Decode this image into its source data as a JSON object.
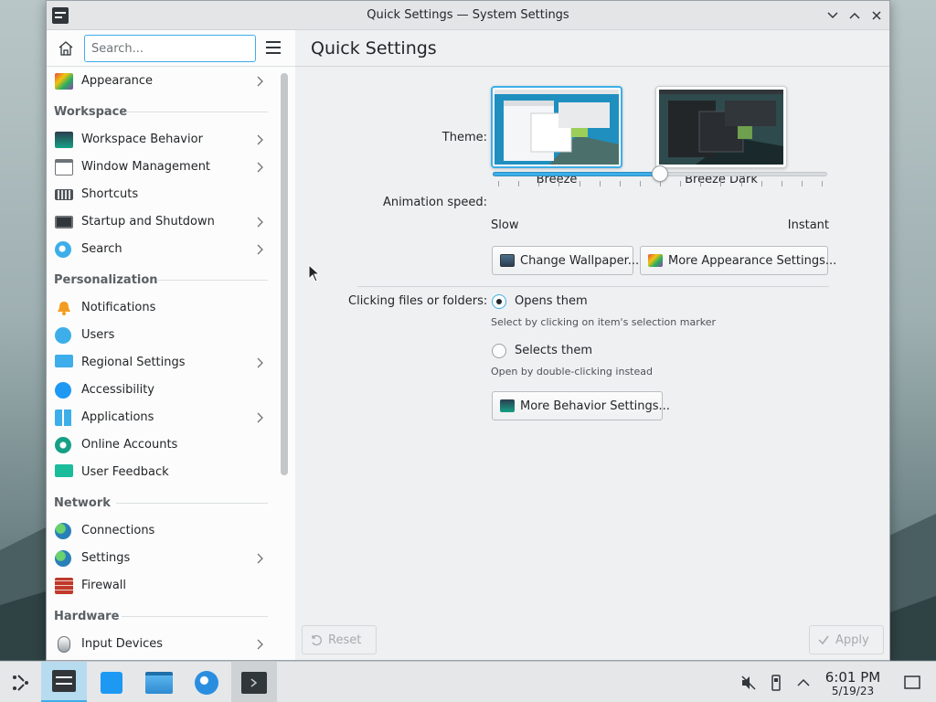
{
  "window": {
    "title": "Quick Settings — System Settings"
  },
  "sidebar": {
    "search_placeholder": "Search...",
    "top_items": [
      {
        "label": "Appearance",
        "icon": "appearance-icon",
        "has_children": true
      }
    ],
    "sections": [
      {
        "title": "Workspace",
        "items": [
          {
            "label": "Workspace Behavior",
            "has_children": true
          },
          {
            "label": "Window Management",
            "has_children": true
          },
          {
            "label": "Shortcuts",
            "has_children": false
          },
          {
            "label": "Startup and Shutdown",
            "has_children": true
          },
          {
            "label": "Search",
            "has_children": true
          }
        ]
      },
      {
        "title": "Personalization",
        "items": [
          {
            "label": "Notifications",
            "has_children": false
          },
          {
            "label": "Users",
            "has_children": false
          },
          {
            "label": "Regional Settings",
            "has_children": true
          },
          {
            "label": "Accessibility",
            "has_children": false
          },
          {
            "label": "Applications",
            "has_children": true
          },
          {
            "label": "Online Accounts",
            "has_children": false
          },
          {
            "label": "User Feedback",
            "has_children": false
          }
        ]
      },
      {
        "title": "Network",
        "items": [
          {
            "label": "Connections",
            "has_children": false
          },
          {
            "label": "Settings",
            "has_children": true
          },
          {
            "label": "Firewall",
            "has_children": false
          }
        ]
      },
      {
        "title": "Hardware",
        "items": [
          {
            "label": "Input Devices",
            "has_children": true
          }
        ]
      }
    ]
  },
  "main": {
    "title": "Quick Settings",
    "theme_label": "Theme:",
    "themes": [
      {
        "name": "Breeze",
        "selected": true
      },
      {
        "name": "Breeze Dark",
        "selected": false
      }
    ],
    "animation_label": "Animation speed:",
    "animation_speed": 0.5,
    "slider_min_label": "Slow",
    "slider_max_label": "Instant",
    "change_wallpaper": "Change Wallpaper...",
    "more_appearance": "More Appearance Settings...",
    "click_label": "Clicking files or folders:",
    "opt_open": "Opens them",
    "opt_open_hint": "Select by clicking on item's selection marker",
    "opt_select": "Selects them",
    "opt_select_hint": "Open by double-clicking instead",
    "selected_option": "opens",
    "more_behavior": "More Behavior Settings...",
    "reset": "Reset",
    "apply": "Apply"
  },
  "taskbar": {
    "time": "6:01 PM",
    "date": "5/19/23"
  },
  "colors": {
    "accent": "#3daee9",
    "window_bg": "#eff0f1",
    "sidebar_bg": "#fcfcfc"
  }
}
